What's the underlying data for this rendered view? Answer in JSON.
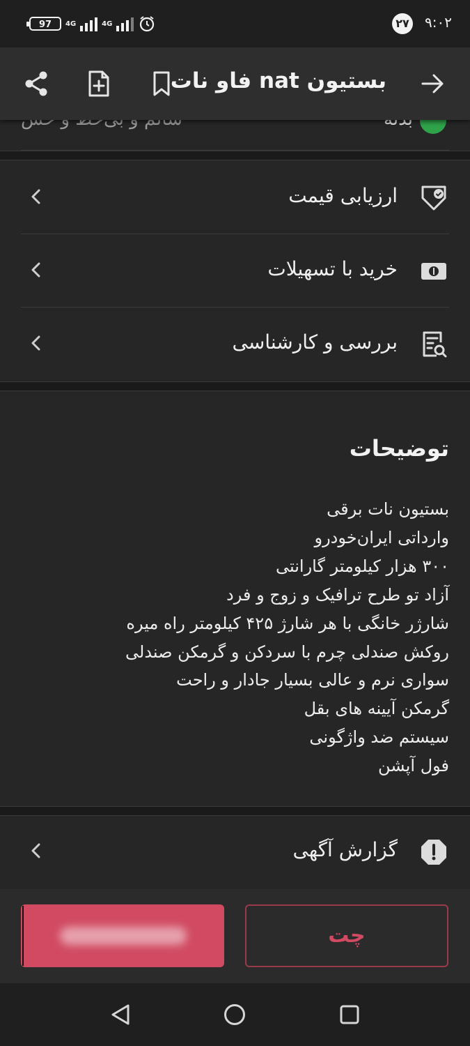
{
  "status_bar": {
    "time": "۹:۰۲",
    "badge": "۲۷",
    "battery": "97",
    "network_1": "4G",
    "network_2": "4G"
  },
  "app_bar": {
    "title": "بستیون nat فاو نات",
    "icons": [
      "back-arrow-icon",
      "bookmark-icon",
      "add-note-icon",
      "share-icon"
    ]
  },
  "peek_row": {
    "right_text": "بدنه",
    "left_text": "سالم و بی‌خط و خش"
  },
  "menu_rows": [
    {
      "label": "ارزیابی قیمت",
      "icon": "price-tag-icon"
    },
    {
      "label": "خرید با تسهیلات",
      "icon": "cash-icon"
    },
    {
      "label": "بررسی و کارشناسی",
      "icon": "inspection-icon"
    }
  ],
  "description": {
    "title": "توضیحات",
    "lines": [
      "بستیون نات برقی",
      "وارداتی ایران‌خودرو",
      "۳۰۰ هزار کیلومتر گارانتی",
      "آزاد تو طرح ترافیک  و  زوج و فرد",
      "شارژر خانگی با هر شارژ ۴۲۵ کیلومتر راه میره",
      "روکش صندلی چرم با سردکن و گرمکن صندلی",
      "سواری نرم و عالی بسیار جادار و راحت",
      "گرمکن آیینه های بقل",
      "سیستم ضد واژگونی",
      "فول آپشن"
    ]
  },
  "report_row": {
    "label": "گزارش آگهی",
    "icon": "warning-icon"
  },
  "bottom_bar": {
    "chat_label": "چت"
  },
  "colors": {
    "accent": "#d14a62",
    "background": "#262626",
    "success": "#2fa34a"
  }
}
